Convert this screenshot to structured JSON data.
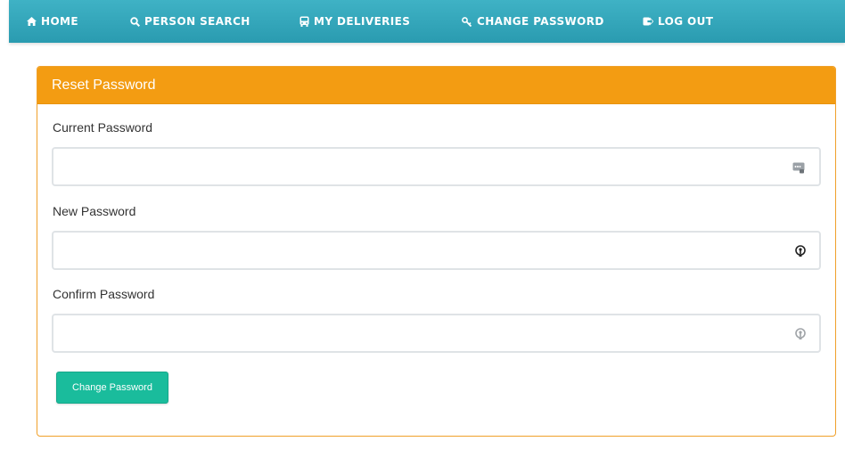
{
  "nav": {
    "items": [
      {
        "label": "HOME",
        "icon": "home-icon"
      },
      {
        "label": "PERSON SEARCH",
        "icon": "search-icon"
      },
      {
        "label": "MY DELIVERIES",
        "icon": "bus-icon"
      },
      {
        "label": "CHANGE PASSWORD",
        "icon": "key-icon"
      },
      {
        "label": "LOG OUT",
        "icon": "sign-out-icon"
      }
    ],
    "background": "#3fb2c5"
  },
  "panel": {
    "title": "Reset Password",
    "header_color": "#f39c12"
  },
  "form": {
    "current_password": {
      "label": "Current Password",
      "value": "",
      "icon": "password-manager-icon"
    },
    "new_password": {
      "label": "New Password",
      "value": "",
      "icon": "password-key-icon"
    },
    "confirm_password": {
      "label": "Confirm Password",
      "value": "",
      "icon": "password-key-icon"
    },
    "submit_label": "Change Password",
    "submit_color": "#1abc9c"
  }
}
